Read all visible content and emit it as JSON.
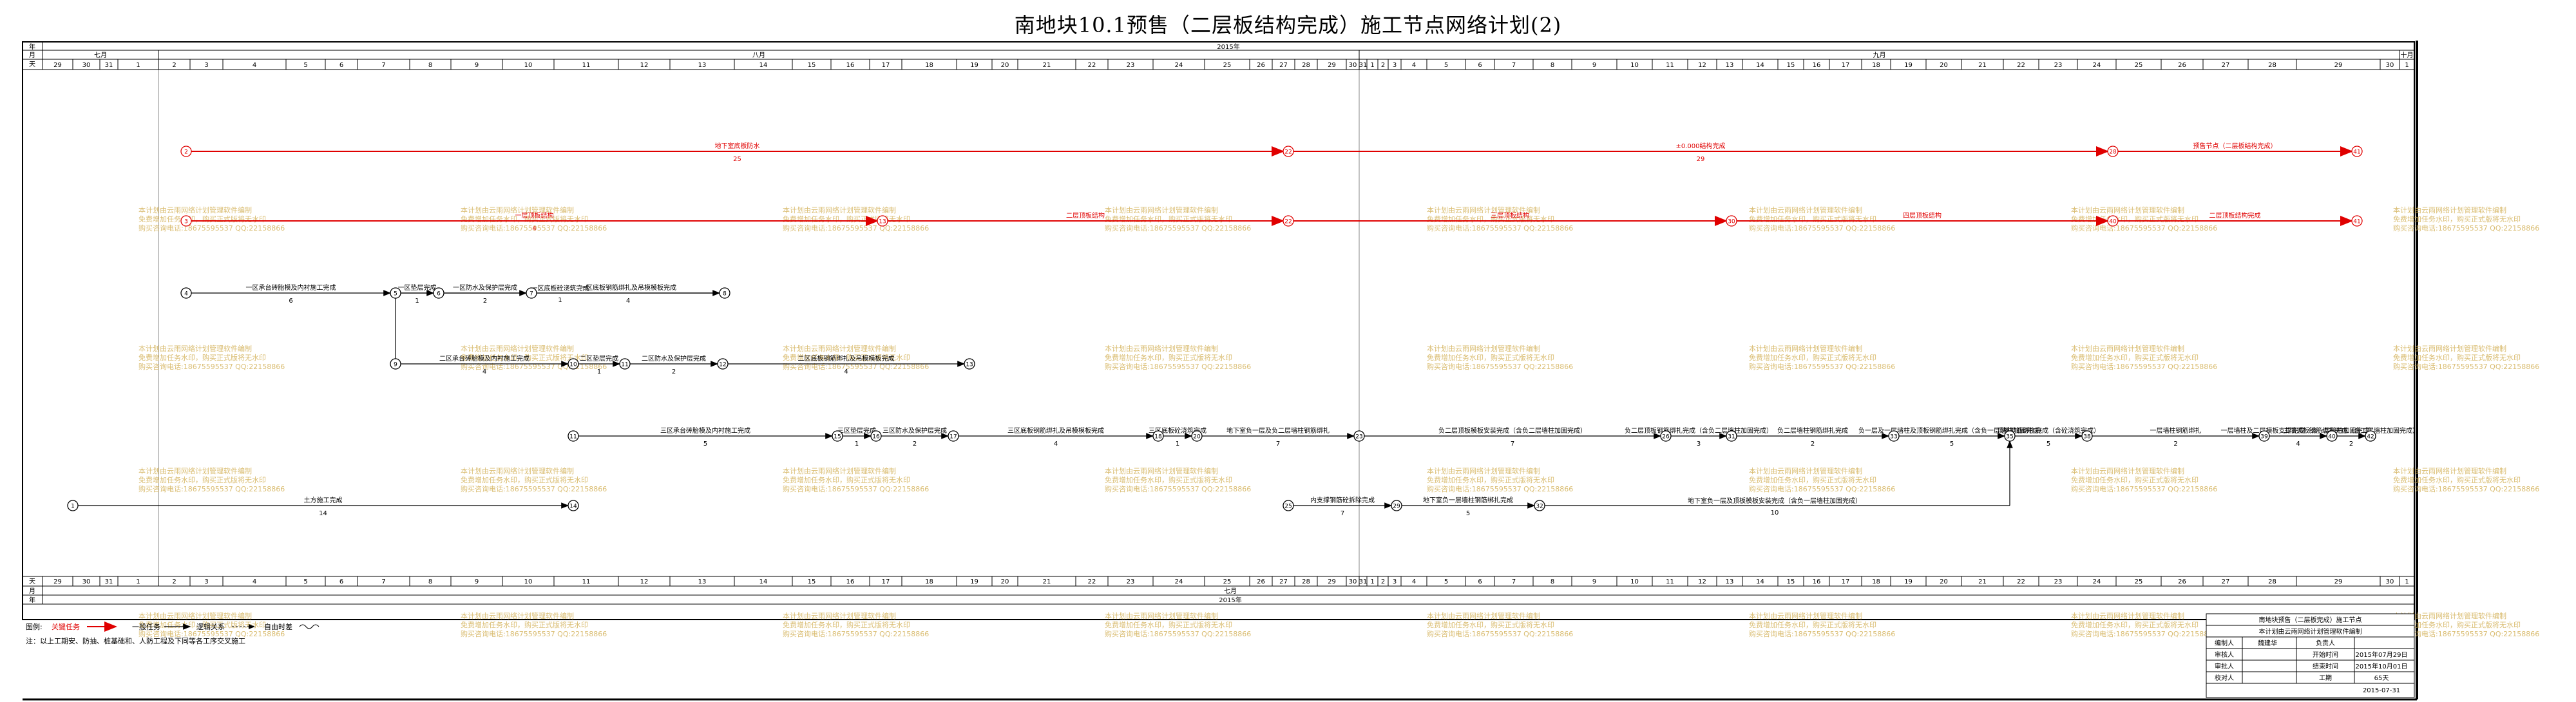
{
  "title": "南地块10.1预售（二层板结构完成）施工节点网络计划(2)",
  "header": {
    "row_labels": [
      "年",
      "月",
      "天"
    ],
    "year": "2015年",
    "months": [
      "七月",
      "八月",
      "九月",
      "十月"
    ],
    "day_ticks": [
      "29",
      "30",
      "31",
      "1",
      "2",
      "3",
      "4",
      "5",
      "6",
      "7",
      "8",
      "9",
      "10",
      "11",
      "12",
      "13",
      "14",
      "15",
      "16",
      "17",
      "18",
      "19",
      "20",
      "21",
      "22",
      "23",
      "24",
      "25",
      "26",
      "27",
      "28",
      "29",
      "30",
      "31",
      "1",
      "2",
      "3",
      "4",
      "5",
      "6",
      "7",
      "8",
      "9",
      "10",
      "11",
      "12",
      "13",
      "14",
      "15",
      "16",
      "17",
      "18",
      "19",
      "20",
      "21",
      "22",
      "23",
      "24",
      "25",
      "26",
      "27",
      "28",
      "29",
      "30",
      "1"
    ]
  },
  "footer": {
    "row_labels": [
      "天",
      "月",
      "年"
    ],
    "month": "七月",
    "year": "2015年"
  },
  "network": {
    "colors": {
      "critical": "#e00000",
      "normal": "#000000",
      "grid": "#999999",
      "watermark": "#d4b25a"
    },
    "nodes": [
      {
        "id": "r1",
        "label": "2"
      },
      {
        "id": "r2",
        "label": "22"
      },
      {
        "id": "r3",
        "label": "28"
      },
      {
        "id": "r4",
        "label": "41"
      },
      {
        "id": "c1",
        "label": "3"
      },
      {
        "id": "c2",
        "label": "13"
      },
      {
        "id": "c3",
        "label": "22"
      },
      {
        "id": "c4",
        "label": "30"
      },
      {
        "id": "c5",
        "label": "40"
      },
      {
        "id": "c6",
        "label": "41"
      },
      {
        "id": "a1",
        "label": "4"
      },
      {
        "id": "a2",
        "label": "5"
      },
      {
        "id": "a3",
        "label": "6"
      },
      {
        "id": "a4",
        "label": "7"
      },
      {
        "id": "a5",
        "label": "8"
      },
      {
        "id": "b1",
        "label": "9"
      },
      {
        "id": "b2",
        "label": "10"
      },
      {
        "id": "b3",
        "label": "11"
      },
      {
        "id": "b4",
        "label": "12"
      },
      {
        "id": "b5",
        "label": "13"
      },
      {
        "id": "d1",
        "label": "11"
      },
      {
        "id": "d2",
        "label": "15"
      },
      {
        "id": "d3",
        "label": "16"
      },
      {
        "id": "d4",
        "label": "17"
      },
      {
        "id": "d5",
        "label": "18"
      },
      {
        "id": "d6",
        "label": "20"
      },
      {
        "id": "d7",
        "label": "23"
      },
      {
        "id": "d8",
        "label": "26"
      },
      {
        "id": "d9",
        "label": "31"
      },
      {
        "id": "d10",
        "label": "33"
      },
      {
        "id": "d11",
        "label": "35"
      },
      {
        "id": "d12",
        "label": "38"
      },
      {
        "id": "d13",
        "label": "39"
      },
      {
        "id": "d14",
        "label": "40"
      },
      {
        "id": "d15",
        "label": "42"
      },
      {
        "id": "e1",
        "label": "1"
      },
      {
        "id": "e2",
        "label": "14"
      },
      {
        "id": "f1",
        "label": "25"
      },
      {
        "id": "f2",
        "label": "29"
      },
      {
        "id": "f3",
        "label": "32"
      }
    ],
    "activities": [
      {
        "from": "r1",
        "to": "r2",
        "name": "地下室底板防水",
        "duration": "25",
        "critical": true
      },
      {
        "from": "r2",
        "to": "r3",
        "name": "±0.000结构完成",
        "duration": "29",
        "critical": true
      },
      {
        "from": "r3",
        "to": "r4",
        "name": "预售节点（二层板结构完成）",
        "duration": "",
        "critical": true
      },
      {
        "from": "c1",
        "to": "c2",
        "name": "一层顶板结构",
        "duration": "4",
        "critical": true
      },
      {
        "from": "c2",
        "to": "c3",
        "name": "二层顶板结构",
        "duration": "",
        "critical": true
      },
      {
        "from": "c3",
        "to": "c4",
        "name": "三层顶板结构",
        "duration": "",
        "critical": true
      },
      {
        "from": "c4",
        "to": "c5",
        "name": "四层顶板结构",
        "duration": "",
        "critical": true
      },
      {
        "from": "c5",
        "to": "c6",
        "name": "二层顶板结构完成",
        "duration": "",
        "critical": true
      },
      {
        "from": "a1",
        "to": "a2",
        "name": "一区承台砖胎模及内衬施工完成",
        "duration": "6",
        "critical": false
      },
      {
        "from": "a2",
        "to": "a3",
        "name": "一区垫层完成",
        "duration": "1",
        "critical": false
      },
      {
        "from": "a3",
        "to": "a4",
        "name": "一区防水及保护层完成",
        "duration": "2",
        "critical": false
      },
      {
        "from": "a4",
        "to": "a5",
        "name": "一区底板钢筋绑扎及吊模模板完成",
        "duration": "4",
        "critical": false
      },
      {
        "from": "a5",
        "to": "b1",
        "name": "一区底板砼浇筑完成",
        "duration": "1",
        "critical": false
      },
      {
        "from": "b1",
        "to": "b2",
        "name": "二区承台砖胎模及内衬施工完成",
        "duration": "4",
        "critical": false
      },
      {
        "from": "b2",
        "to": "b3",
        "name": "二区垫层完成",
        "duration": "1",
        "critical": false
      },
      {
        "from": "b3",
        "to": "b4",
        "name": "二区防水及保护层完成",
        "duration": "2",
        "critical": false
      },
      {
        "from": "b4",
        "to": "b5",
        "name": "二区底板钢筋绑扎及吊模模板完成",
        "duration": "4",
        "critical": false
      },
      {
        "from": "b5",
        "to": "b5",
        "name": "二区底板砼浇筑完成",
        "duration": "1",
        "critical": false
      },
      {
        "from": "d1",
        "to": "d2",
        "name": "三区承台砖胎模及内衬施工完成",
        "duration": "5",
        "critical": false
      },
      {
        "from": "d2",
        "to": "d3",
        "name": "三区垫层完成",
        "duration": "1",
        "critical": false
      },
      {
        "from": "d3",
        "to": "d4",
        "name": "三区防水及保护层完成",
        "duration": "2",
        "critical": false
      },
      {
        "from": "d4",
        "to": "d5",
        "name": "三区底板钢筋绑扎及吊模模板完成",
        "duration": "4",
        "critical": false
      },
      {
        "from": "d5",
        "to": "d6",
        "name": "三区底板砼浇筑完成",
        "duration": "1",
        "critical": false
      },
      {
        "from": "d6",
        "to": "d7",
        "name": "地下室负一层及负二层墙柱钢筋绑扎",
        "duration": "7",
        "critical": false
      },
      {
        "from": "d7",
        "to": "d8",
        "name": "负二层顶板模板安装完成（含负二层墙柱加固完成）",
        "duration": "7",
        "critical": false
      },
      {
        "from": "d8",
        "to": "d9",
        "name": "负二层顶板钢筋绑扎完成（含负二层墙柱加固完成）",
        "duration": "3",
        "critical": false
      },
      {
        "from": "d9",
        "to": "d10",
        "name": "负二层墙柱钢筋绑扎完成",
        "duration": "2",
        "critical": false
      },
      {
        "from": "d10",
        "to": "d11",
        "name": "负一层及一层墙柱及顶板钢筋绑扎完成（含负一层墙柱加固完成）",
        "duration": "5",
        "critical": false
      },
      {
        "from": "d11",
        "to": "d12",
        "name": "顶板钢筋绑扎完成（含砼浇筑完成）",
        "duration": "5",
        "critical": false
      },
      {
        "from": "d12",
        "to": "d13",
        "name": "一层墙柱钢筋绑扎",
        "duration": "2",
        "critical": false
      },
      {
        "from": "d13",
        "to": "d14",
        "name": "一层墙柱及二层模板支撑完成（含一层墙柱加固完成）",
        "duration": "4",
        "critical": false
      },
      {
        "from": "d14",
        "to": "d15",
        "name": "二层顶板钢筋绑扎完成（含二层墙柱加固完成）",
        "duration": "2",
        "critical": false
      },
      {
        "from": "e1",
        "to": "e2",
        "name": "土方施工完成",
        "duration": "14",
        "critical": false
      },
      {
        "from": "f1",
        "to": "f2",
        "name": "内支撑钢筋砼拆除完成",
        "duration": "7",
        "critical": false
      },
      {
        "from": "f2",
        "to": "f3",
        "name": "地下室负一层墙柱钢筋绑扎完成",
        "duration": "5",
        "critical": false
      },
      {
        "from": "f3",
        "to": "d11",
        "name": "地下室负一层及顶板模板安装完成（含负一层墙柱加固完成）",
        "duration": "10",
        "critical": false
      }
    ]
  },
  "watermark": {
    "lines": [
      "本计划由云雨网络计划管理软件编制",
      "免费增加任务水印，购买正式版将无水印",
      "购买咨询电话:18675595537 QQ:22158866"
    ]
  },
  "legend": {
    "label": "图例:",
    "critical_label": "关键任务",
    "normal_label": "一般任务",
    "logic_label": "逻辑关系",
    "float_label": "自由时差",
    "note": "注：以上工期安、防抽、桩基础和、人防工程及下同等各工序交叉施工"
  },
  "title_block": {
    "project": "南地块预售（二层板完成）施工节点",
    "subtitle": "本计划由云雨网络计划管理软件编制",
    "rows": [
      {
        "k": "编制人",
        "v": "魏建华",
        "k2": "负责人",
        "v2": ""
      },
      {
        "k": "审核人",
        "v": "",
        "k2": "开始时间",
        "v2": "2015年07月29日"
      },
      {
        "k": "审批人",
        "v": "",
        "k2": "结束时间",
        "v2": "2015年10月01日"
      },
      {
        "k": "校对人",
        "v": "",
        "k2": "工期",
        "v2": "65天"
      }
    ],
    "date": "2015-07-31"
  }
}
